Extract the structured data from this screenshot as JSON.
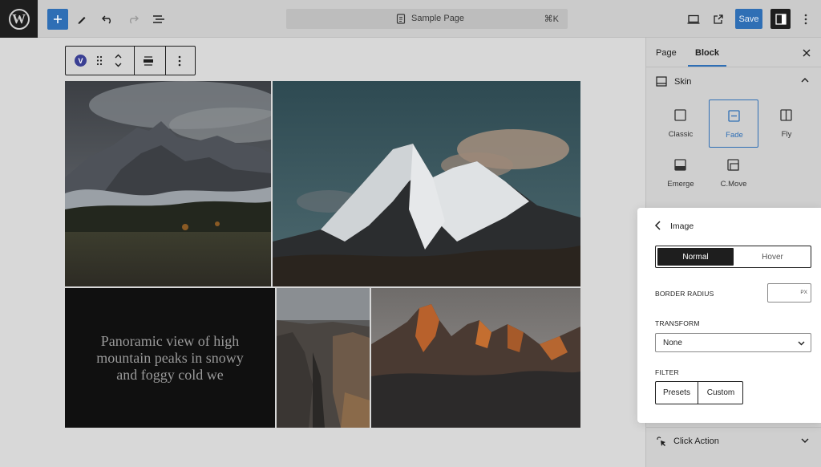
{
  "topbar": {
    "document_title": "Sample Page",
    "shortcut": "⌘K",
    "save_label": "Save"
  },
  "block_toolbar": {
    "badge_letter": "V"
  },
  "gallery": {
    "caption": "Panoramic view of high mountain peaks in snowy and foggy cold we"
  },
  "sidebar": {
    "tabs": [
      {
        "label": "Page"
      },
      {
        "label": "Block"
      }
    ],
    "skin": {
      "title": "Skin",
      "options": [
        {
          "label": "Classic",
          "icon": "square-icon"
        },
        {
          "label": "Fade",
          "icon": "fade-icon",
          "selected": true
        },
        {
          "label": "Fly",
          "icon": "columns-icon"
        },
        {
          "label": "Emerge",
          "icon": "emerge-icon"
        },
        {
          "label": "C.Move",
          "icon": "c-move-icon"
        }
      ]
    },
    "click_action": {
      "title": "Click Action"
    }
  },
  "popover": {
    "title": "Image",
    "state_tabs": {
      "normal": "Normal",
      "hover": "Hover"
    },
    "border_radius": {
      "label": "BORDER RADIUS",
      "value": "",
      "unit": "PX"
    },
    "transform": {
      "label": "TRANSFORM",
      "value": "None"
    },
    "filter": {
      "label": "FILTER",
      "presets": "Presets",
      "custom": "Custom"
    }
  },
  "colors": {
    "accent": "#2f6fb5",
    "dark": "#1e1e1e"
  }
}
